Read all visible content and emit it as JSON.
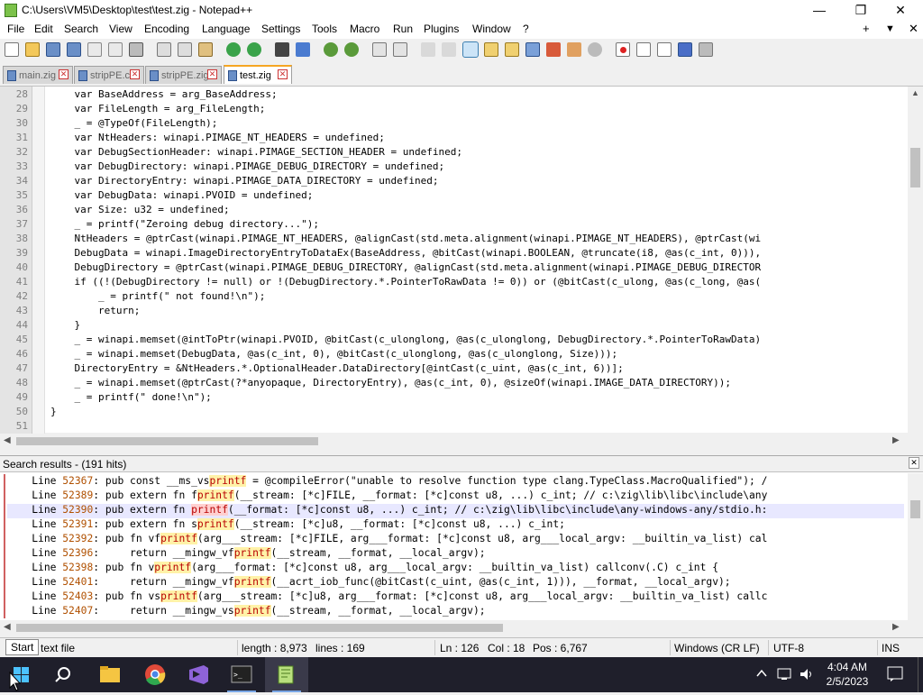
{
  "window": {
    "title": "C:\\Users\\VM5\\Desktop\\test\\test.zig - Notepad++",
    "controls": {
      "minimize": "—",
      "maximize": "❐",
      "close": "✕"
    }
  },
  "menubar": {
    "items": [
      "File",
      "Edit",
      "Search",
      "View",
      "Encoding",
      "Language",
      "Settings",
      "Tools",
      "Macro",
      "Run",
      "Plugins",
      "Window",
      "?"
    ],
    "right": {
      "plus": "+",
      "dropdown": "▼",
      "close": "✕"
    }
  },
  "tabs": [
    {
      "label": "main.zig",
      "active": false
    },
    {
      "label": "stripPE.c",
      "active": false
    },
    {
      "label": "stripPE.zig",
      "active": false
    },
    {
      "label": "test.zig",
      "active": true
    }
  ],
  "editor": {
    "lines": [
      {
        "n": "28",
        "text": "    var BaseAddress = arg_BaseAddress;"
      },
      {
        "n": "29",
        "text": "    var FileLength = arg_FileLength;"
      },
      {
        "n": "30",
        "text": "    _ = @TypeOf(FileLength);"
      },
      {
        "n": "31",
        "text": "    var NtHeaders: winapi.PIMAGE_NT_HEADERS = undefined;"
      },
      {
        "n": "32",
        "text": "    var DebugSectionHeader: winapi.PIMAGE_SECTION_HEADER = undefined;"
      },
      {
        "n": "33",
        "text": "    var DebugDirectory: winapi.PIMAGE_DEBUG_DIRECTORY = undefined;"
      },
      {
        "n": "34",
        "text": "    var DirectoryEntry: winapi.PIMAGE_DATA_DIRECTORY = undefined;"
      },
      {
        "n": "35",
        "text": "    var DebugData: winapi.PVOID = undefined;"
      },
      {
        "n": "36",
        "text": "    var Size: u32 = undefined;"
      },
      {
        "n": "37",
        "text": "    _ = printf(\"Zeroing debug directory...\");"
      },
      {
        "n": "38",
        "text": "    NtHeaders = @ptrCast(winapi.PIMAGE_NT_HEADERS, @alignCast(std.meta.alignment(winapi.PIMAGE_NT_HEADERS), @ptrCast(wi"
      },
      {
        "n": "39",
        "text": "    DebugData = winapi.ImageDirectoryEntryToDataEx(BaseAddress, @bitCast(winapi.BOOLEAN, @truncate(i8, @as(c_int, 0))),"
      },
      {
        "n": "40",
        "text": "    DebugDirectory = @ptrCast(winapi.PIMAGE_DEBUG_DIRECTORY, @alignCast(std.meta.alignment(winapi.PIMAGE_DEBUG_DIRECTOR"
      },
      {
        "n": "41",
        "text": "    if ((!(DebugDirectory != null) or !(DebugDirectory.*.PointerToRawData != 0)) or (@bitCast(c_ulong, @as(c_long, @as("
      },
      {
        "n": "42",
        "text": "        _ = printf(\" not found!\\n\");"
      },
      {
        "n": "43",
        "text": "        return;"
      },
      {
        "n": "44",
        "text": "    }"
      },
      {
        "n": "45",
        "text": "    _ = winapi.memset(@intToPtr(winapi.PVOID, @bitCast(c_ulonglong, @as(c_ulonglong, DebugDirectory.*.PointerToRawData)"
      },
      {
        "n": "46",
        "text": "    _ = winapi.memset(DebugData, @as(c_int, 0), @bitCast(c_ulonglong, @as(c_ulonglong, Size)));"
      },
      {
        "n": "47",
        "text": "    DirectoryEntry = &NtHeaders.*.OptionalHeader.DataDirectory[@intCast(c_uint, @as(c_int, 6))];"
      },
      {
        "n": "48",
        "text": "    _ = winapi.memset(@ptrCast(?*anyopaque, DirectoryEntry), @as(c_int, 0), @sizeOf(winapi.IMAGE_DATA_DIRECTORY));"
      },
      {
        "n": "49",
        "text": "    _ = printf(\" done!\\n\");"
      },
      {
        "n": "50",
        "text": "}"
      },
      {
        "n": "51",
        "text": ""
      }
    ]
  },
  "search_results": {
    "title": "Search results - (191 hits)",
    "close": "✕",
    "rows": [
      {
        "label": "Line ",
        "num": "52367",
        "pre": ": pub const __ms_vs",
        "hit": "printf",
        "post": " = @compileError(\"unable to resolve function type clang.TypeClass.MacroQualified\"); /",
        "selected": false
      },
      {
        "label": "Line ",
        "num": "52389",
        "pre": ": pub extern fn f",
        "hit": "printf",
        "post": "(__stream: [*c]FILE, __format: [*c]const u8, ...) c_int; // c:\\zig\\lib\\libc\\include\\any",
        "selected": false
      },
      {
        "label": "Line ",
        "num": "52390",
        "pre": ": pub extern fn ",
        "hit": "printf",
        "post": "(__format: [*c]const u8, ...) c_int; // c:\\zig\\lib\\libc\\include\\any-windows-any/stdio.h:",
        "selected": true
      },
      {
        "label": "Line ",
        "num": "52391",
        "pre": ": pub extern fn s",
        "hit": "printf",
        "post": "(__stream: [*c]u8, __format: [*c]const u8, ...) c_int;",
        "selected": false
      },
      {
        "label": "Line ",
        "num": "52392",
        "pre": ": pub fn vf",
        "hit": "printf",
        "post": "(arg___stream: [*c]FILE, arg___format: [*c]const u8, arg___local_argv: __builtin_va_list) cal",
        "selected": false
      },
      {
        "label": "Line ",
        "num": "52396",
        "pre": ":     return __mingw_vf",
        "hit": "printf",
        "post": "(__stream, __format, __local_argv);",
        "selected": false
      },
      {
        "label": "Line ",
        "num": "52398",
        "pre": ": pub fn v",
        "hit": "printf",
        "post": "(arg___format: [*c]const u8, arg___local_argv: __builtin_va_list) callconv(.C) c_int {",
        "selected": false
      },
      {
        "label": "Line ",
        "num": "52401",
        "pre": ":     return __mingw_vf",
        "hit": "printf",
        "post": "(__acrt_iob_func(@bitCast(c_uint, @as(c_int, 1))), __format, __local_argv);",
        "selected": false
      },
      {
        "label": "Line ",
        "num": "52403",
        "pre": ": pub fn vs",
        "hit": "printf",
        "post": "(arg___stream: [*c]u8, arg___format: [*c]const u8, arg___local_argv: __builtin_va_list) callc",
        "selected": false
      },
      {
        "label": "Line ",
        "num": "52407",
        "pre": ":     return __mingw_vs",
        "hit": "printf",
        "post": "(__stream, __format, __local_argv);",
        "selected": false
      }
    ]
  },
  "statusbar": {
    "start": "Start",
    "filetype": "text file",
    "length": "length : 8,973",
    "lines": "lines : 169",
    "ln": "Ln : 126",
    "col": "Col : 18",
    "pos": "Pos : 6,767",
    "eol": "Windows (CR LF)",
    "encoding": "UTF-8",
    "mode": "INS"
  },
  "taskbar": {
    "time": "4:04 AM",
    "date": "2/5/2023"
  },
  "colors": {
    "accent_tab": "#f5a623",
    "hit": "#b80000",
    "line_number": "#b05000"
  }
}
